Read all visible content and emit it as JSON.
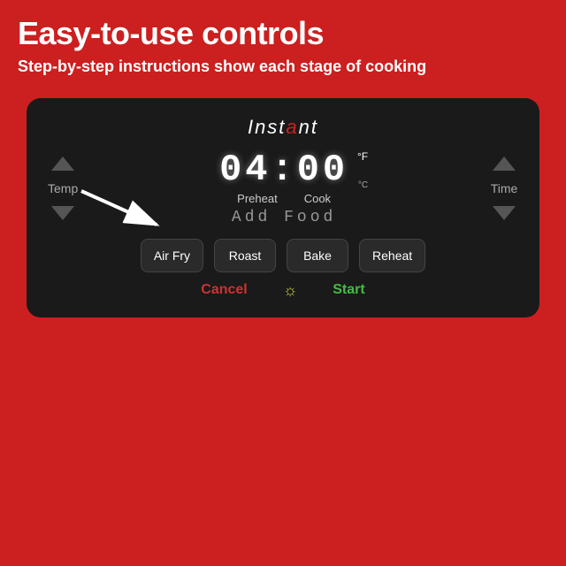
{
  "header": {
    "main_title": "Easy-to-use controls",
    "subtitle": "Step-by-step instructions show each stage of cooking"
  },
  "device": {
    "brand": "Instant",
    "time_display": "04:00",
    "temp_unit": "°F",
    "cook_sub": "°C",
    "label_preheat": "Preheat",
    "label_cook": "Cook",
    "add_food": "Add Food",
    "label_temp": "Temp",
    "label_time": "Time",
    "buttons": [
      {
        "label": "Air Fry"
      },
      {
        "label": "Roast"
      },
      {
        "label": "Bake"
      },
      {
        "label": "Reheat"
      }
    ],
    "cancel_label": "Cancel",
    "start_label": "Start",
    "light_icon": "☼"
  }
}
